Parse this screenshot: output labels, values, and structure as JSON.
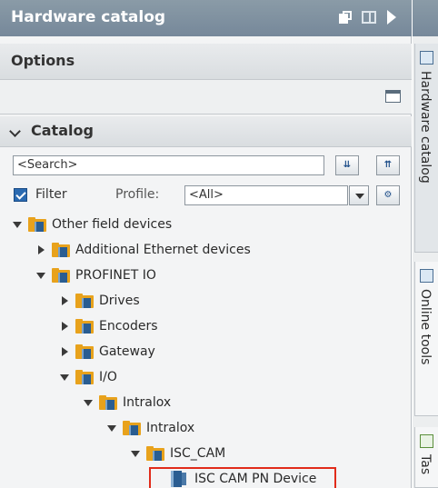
{
  "panel": {
    "title": "Hardware catalog",
    "options_label": "Options",
    "catalog_label": "Catalog",
    "icons": [
      "float-icon",
      "split-icon",
      "collapse-arrow-icon"
    ]
  },
  "search": {
    "value": "<Search>"
  },
  "filter": {
    "checked": true,
    "label": "Filter",
    "profile_label": "Profile:",
    "profile_value": "<All>"
  },
  "tree": [
    {
      "label": "Other field devices",
      "level": 0,
      "expanded": true,
      "icon": "folder-icon"
    },
    {
      "label": "Additional Ethernet devices",
      "level": 1,
      "expanded": false,
      "icon": "folder-icon"
    },
    {
      "label": "PROFINET IO",
      "level": 1,
      "expanded": true,
      "icon": "folder-icon"
    },
    {
      "label": "Drives",
      "level": 2,
      "expanded": false,
      "icon": "folder-icon"
    },
    {
      "label": "Encoders",
      "level": 2,
      "expanded": false,
      "icon": "folder-icon"
    },
    {
      "label": "Gateway",
      "level": 2,
      "expanded": false,
      "icon": "folder-icon"
    },
    {
      "label": "I/O",
      "level": 2,
      "expanded": true,
      "icon": "folder-icon"
    },
    {
      "label": "Intralox",
      "level": 3,
      "expanded": true,
      "icon": "folder-icon"
    },
    {
      "label": "Intralox",
      "level": 4,
      "expanded": true,
      "icon": "folder-icon"
    },
    {
      "label": "ISC_CAM",
      "level": 5,
      "expanded": true,
      "icon": "folder-icon"
    },
    {
      "label": "ISC CAM PN Device",
      "level": 6,
      "icon": "device-icon",
      "selected": true
    }
  ],
  "side_tabs": [
    {
      "label": "Hardware catalog",
      "icon": "catalog-icon"
    },
    {
      "label": "Online tools",
      "icon": "online-tools-icon"
    },
    {
      "label": "Tas",
      "icon": "tasks-icon"
    }
  ],
  "colors": {
    "title_bar": "#7f91a0",
    "selection_highlight": "#e12b1a",
    "folder": "#e8a21c",
    "checkbox": "#2a6ab1"
  }
}
